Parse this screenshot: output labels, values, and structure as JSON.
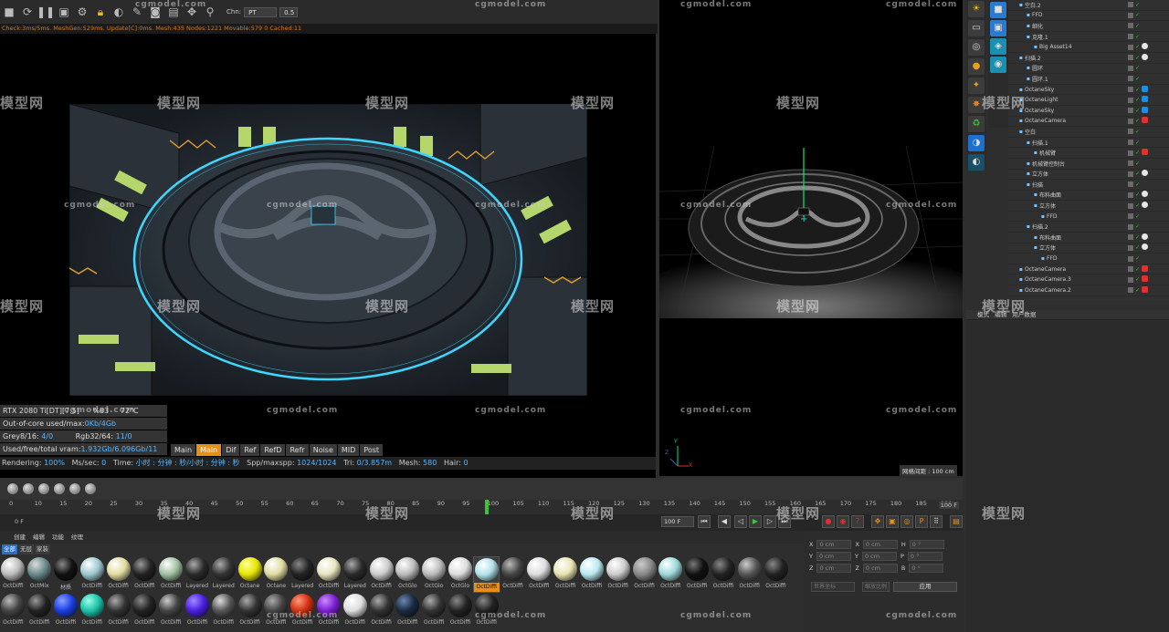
{
  "toolbar": {
    "icons": [
      "stop-icon",
      "refresh-icon",
      "pause-icon",
      "region-icon",
      "settings-icon",
      "lock-icon",
      "material-icon",
      "picker-icon",
      "camera-icon",
      "image-icon",
      "pan-icon",
      "pin-icon"
    ],
    "channel_label": "Chn:",
    "channel_value": "PT",
    "zoom_value": "0.5"
  },
  "stats_line": "Check:3ms/5ms. MeshGen:529ms. Update[C]:0ms. Mesh:435 Nodes:1221 Movable:579 0 Cached:11",
  "hud": {
    "gpu": "RTX 2080 Ti[DT][7.5]",
    "gpu_pct": "%83",
    "gpu_temp": "72°C",
    "out_of_core_label": "Out-of-core used/max:",
    "out_of_core_value": "0Kb/4Gb",
    "grey_label": "Grey8/16:",
    "grey_value": "4/0",
    "rgb_label": "Rgb32/64:",
    "rgb_value": "11/0",
    "vram_label": "Used/free/total vram:",
    "vram_value": "1.932Gb/6.096Gb/11"
  },
  "render_tabs": [
    "Main",
    "Main",
    "Dif",
    "Ref",
    "RefD",
    "Refr",
    "Noise",
    "MID",
    "Post"
  ],
  "render_tab_active": 1,
  "render_status": {
    "rendering_label": "Rendering:",
    "rendering_value": "100%",
    "ms_label": "Ms/sec:",
    "ms_value": "0",
    "time_label": "Time:",
    "time_value": "小时 : 分钟 : 秒/小时 : 分钟 : 秒",
    "spp_label": "Spp/maxspp:",
    "spp_value": "1024/1024",
    "tri_label": "Tri:",
    "tri_value": "0/3.857m",
    "mesh_label": "Mesh:",
    "mesh_value": "580",
    "hair_label": "Hair:",
    "hair_value": "0"
  },
  "viewport": {
    "grid_spacing": "网格间距 : 100 cm",
    "axis_y": "Y",
    "axis_z": "Z",
    "axis_x": "X"
  },
  "objects": [
    {
      "name": "空白.2",
      "tag": ""
    },
    {
      "name": "FFD",
      "tag": ""
    },
    {
      "name": "细化",
      "tag": ""
    },
    {
      "name": "克隆.1",
      "tag": ""
    },
    {
      "name": "Big Asset14",
      "tag": "mat"
    },
    {
      "name": "扫描.2",
      "tag": "mat"
    },
    {
      "name": "圆环",
      "tag": ""
    },
    {
      "name": "圆环.1",
      "tag": ""
    },
    {
      "name": "OctaneSky",
      "tag": "blue"
    },
    {
      "name": "OctaneLight",
      "tag": "blue"
    },
    {
      "name": "OctaneSky",
      "tag": "blue"
    },
    {
      "name": "OctaneCamera",
      "tag": "red"
    },
    {
      "name": "空白",
      "tag": ""
    },
    {
      "name": "扫描.1",
      "tag": ""
    },
    {
      "name": "机械臂",
      "tag": "x"
    },
    {
      "name": "机械臂控制台",
      "tag": ""
    },
    {
      "name": "立方体",
      "tag": "mat"
    },
    {
      "name": "扫描",
      "tag": ""
    },
    {
      "name": "布料曲面",
      "tag": "mat"
    },
    {
      "name": "立方体",
      "tag": "mat"
    },
    {
      "name": "FFD",
      "tag": ""
    },
    {
      "name": "扫描.2",
      "tag": ""
    },
    {
      "name": "布料曲面",
      "tag": "mat"
    },
    {
      "name": "立方体",
      "tag": "mat"
    },
    {
      "name": "FFD",
      "tag": ""
    },
    {
      "name": "OctaneCamera",
      "tag": "red"
    },
    {
      "name": "OctaneCamera.3",
      "tag": "red"
    },
    {
      "name": "OctaneCamera.2",
      "tag": "red"
    }
  ],
  "attr_tabs": [
    "模式",
    "编辑",
    "用户数据"
  ],
  "timeline": {
    "ticks": [
      "0",
      "10",
      "15",
      "20",
      "25",
      "30",
      "35",
      "40",
      "45",
      "50",
      "55",
      "60",
      "65",
      "70",
      "75",
      "80",
      "85",
      "90",
      "95",
      "100",
      "105",
      "110",
      "115",
      "120",
      "125",
      "130",
      "135",
      "140",
      "145",
      "150",
      "155",
      "160",
      "165",
      "170",
      "175",
      "180",
      "185",
      "190"
    ],
    "current": "100",
    "start_frame": "0 F",
    "end_frame": "100 F",
    "end_frame2": "100 F"
  },
  "material_header": [
    "创建",
    "编辑",
    "功能",
    "纹理"
  ],
  "material_filters": [
    "全部",
    "无层",
    "家装"
  ],
  "materials": [
    {
      "label": "OctDiffi",
      "color": "#bbbbbb",
      "hi": "#ffffff"
    },
    {
      "label": "OctMix",
      "color": "#6a8a8a",
      "hi": "#dddddd"
    },
    {
      "label": "材质",
      "color": "#111111",
      "hi": "#888888"
    },
    {
      "label": "OctDiffi",
      "color": "#9ec8d0",
      "hi": "#ffffff"
    },
    {
      "label": "OctDiffi",
      "color": "#e0dca0",
      "hi": "#ffffff"
    },
    {
      "label": "OctDiffi",
      "color": "#222222",
      "hi": "#999999"
    },
    {
      "label": "OctDiffi",
      "color": "#a0c0a0",
      "hi": "#ffffff"
    },
    {
      "label": "Layered",
      "color": "#2a2a2a",
      "hi": "#aaaaaa"
    },
    {
      "label": "Layered",
      "color": "#333333",
      "hi": "#aaaaaa"
    },
    {
      "label": "Octane",
      "color": "#e6e600",
      "hi": "#ffff99"
    },
    {
      "label": "Octane",
      "color": "#e0dca0",
      "hi": "#ffffff"
    },
    {
      "label": "Layered",
      "color": "#222222",
      "hi": "#888888"
    },
    {
      "label": "OctDiffi",
      "color": "#e8e4c0",
      "hi": "#ffffff"
    },
    {
      "label": "Layered",
      "color": "#2a2a2a",
      "hi": "#aaaaaa"
    },
    {
      "label": "OctDiffi",
      "color": "#cccccc",
      "hi": "#ffffff"
    },
    {
      "label": "OctGlo",
      "color": "#bbbbbb",
      "hi": "#ffffff"
    },
    {
      "label": "OctGlo",
      "color": "#bbbbbb",
      "hi": "#ffffff"
    },
    {
      "label": "OctGlo",
      "color": "#dddddd",
      "hi": "#ffffff"
    },
    {
      "label": "OctDiffi",
      "color": "#b0e0e8",
      "hi": "#ffffff"
    },
    {
      "label": "OctDiffi",
      "color": "#444444",
      "hi": "#bbbbbb"
    },
    {
      "label": "OctDiffi",
      "color": "#dddddd",
      "hi": "#ffffff"
    },
    {
      "label": "OctDiffi",
      "color": "#e8e4b0",
      "hi": "#ffffff"
    },
    {
      "label": "OctDiffi",
      "color": "#b8eaf0",
      "hi": "#ffffff"
    },
    {
      "label": "OctDiffi",
      "color": "#cccccc",
      "hi": "#ffffff"
    },
    {
      "label": "OctDiffi",
      "color": "#888888",
      "hi": "#cccccc"
    },
    {
      "label": "OctDiffi",
      "color": "#9ed8d8",
      "hi": "#ffffff"
    },
    {
      "label": "OctDiffi",
      "color": "#111111",
      "hi": "#777777"
    },
    {
      "label": "OctDiffi",
      "color": "#222222",
      "hi": "#888888"
    },
    {
      "label": "OctDiffi",
      "color": "#555555",
      "hi": "#cccccc"
    },
    {
      "label": "OctDiffi",
      "color": "#222222",
      "hi": "#888888"
    },
    {
      "label": "OctDiffi",
      "color": "#444444",
      "hi": "#bbbbbb"
    },
    {
      "label": "OctDiffi",
      "color": "#222222",
      "hi": "#999999"
    },
    {
      "label": "OctDiffi",
      "color": "#1a3ee0",
      "hi": "#8aa0ff"
    },
    {
      "label": "OctDiffi",
      "color": "#1ec0a8",
      "hi": "#9affea"
    },
    {
      "label": "OctDiffi",
      "color": "#333333",
      "hi": "#aaaaaa"
    },
    {
      "label": "OctDiffi",
      "color": "#222222",
      "hi": "#888888"
    },
    {
      "label": "OctDiffi",
      "color": "#444444",
      "hi": "#cccccc"
    },
    {
      "label": "OctDiffi",
      "color": "#4a1ee0",
      "hi": "#a08aff"
    },
    {
      "label": "OctDiffi",
      "color": "#555555",
      "hi": "#dddddd"
    },
    {
      "label": "OctDiffi",
      "color": "#333333",
      "hi": "#aaaaaa"
    },
    {
      "label": "OctDiffi",
      "color": "#444444",
      "hi": "#aaaaaa"
    },
    {
      "label": "OctDiffi",
      "color": "#d03010",
      "hi": "#ff9a7a"
    },
    {
      "label": "OctDiffi",
      "color": "#7a1ed0",
      "hi": "#cc8aff"
    },
    {
      "label": "OctDiffi",
      "color": "#dddddd",
      "hi": "#ffffff"
    },
    {
      "label": "OctDiffi",
      "color": "#333333",
      "hi": "#aaaaaa"
    },
    {
      "label": "OctDiffi",
      "color": "#1a2a40",
      "hi": "#6a88b0"
    },
    {
      "label": "OctDiffi",
      "color": "#333333",
      "hi": "#aaaaaa"
    },
    {
      "label": "OctDiffi",
      "color": "#222222",
      "hi": "#888888"
    },
    {
      "label": "OctDiffi",
      "color": "#222222",
      "hi": "#888888"
    }
  ],
  "selected_material_index": 18,
  "coords": {
    "x_label": "X",
    "y_label": "Y",
    "z_label": "Z",
    "x_val": "0 cm",
    "y_val": "0 cm",
    "z_val": "0 cm",
    "x2": "0 cm",
    "y2": "0 cm",
    "z2": "0 cm",
    "h_label": "H",
    "p_label": "P",
    "b_label": "B",
    "h_val": "0 °",
    "p_val": "0 °",
    "b_val": "0 °",
    "world_drop": "世界坐标",
    "scale_drop": "缩放比例",
    "apply": "应用"
  },
  "watermark_text": "模型网",
  "watermark_url": "cgmodel.com",
  "colors": {
    "accent": "#e6901a",
    "hud_blue": "#5bb6ff",
    "ring_cyan": "#3fd6ff",
    "stats_orange": "#d87a1a"
  }
}
